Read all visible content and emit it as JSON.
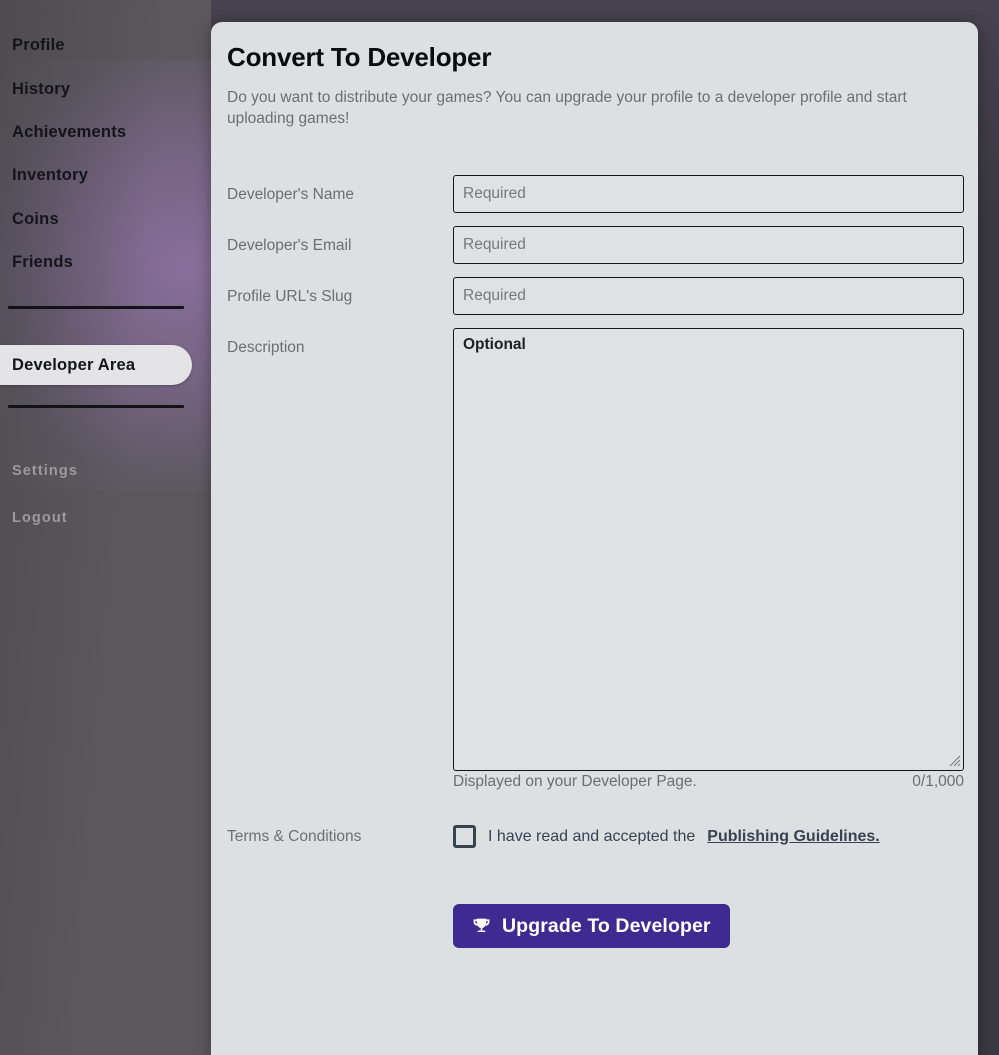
{
  "theme": {
    "accent": "#3d2b91",
    "modal_bg": "#dde0e2",
    "backdrop": "#3a3840",
    "sidebar_bg": "#5a585c",
    "sidebar_glow": "#8b709e",
    "label_color": "#6b6f72",
    "checkbox_color": "#3a4250",
    "active_pill_bg": "#e4e4e6"
  },
  "sidebar": {
    "items": [
      {
        "label": "Profile",
        "active": false,
        "muted": false
      },
      {
        "label": "History",
        "active": false,
        "muted": false
      },
      {
        "label": "Achievements",
        "active": false,
        "muted": false
      },
      {
        "label": "Inventory",
        "active": false,
        "muted": false
      },
      {
        "label": "Coins",
        "active": false,
        "muted": false
      },
      {
        "label": "Friends",
        "active": false,
        "muted": false
      },
      {
        "label": "Developer Area",
        "active": true,
        "muted": false
      },
      {
        "label": "Settings",
        "active": false,
        "muted": true
      },
      {
        "label": "Logout",
        "active": false,
        "muted": true
      }
    ]
  },
  "modal": {
    "title": "Convert To Developer",
    "subtitle": "Do you want to distribute your games? You can upgrade your profile to a developer profile and start uploading games!",
    "fields": {
      "name": {
        "label": "Developer's Name",
        "placeholder": "Required",
        "value": ""
      },
      "email": {
        "label": "Developer's Email",
        "placeholder": "Required",
        "value": ""
      },
      "slug": {
        "label": "Profile URL's Slug",
        "placeholder": "Required",
        "value": ""
      },
      "description": {
        "label": "Description",
        "placeholder": "Optional",
        "value": "",
        "helper": "Displayed on your Developer Page.",
        "counter": "0/1,000",
        "max_length": 1000
      }
    },
    "terms": {
      "label": "Terms & Conditions",
      "text": "I have read and accepted the",
      "link": "Publishing Guidelines.",
      "checked": false
    },
    "submit": {
      "label": "Upgrade To Developer",
      "icon": "trophy-icon"
    }
  }
}
